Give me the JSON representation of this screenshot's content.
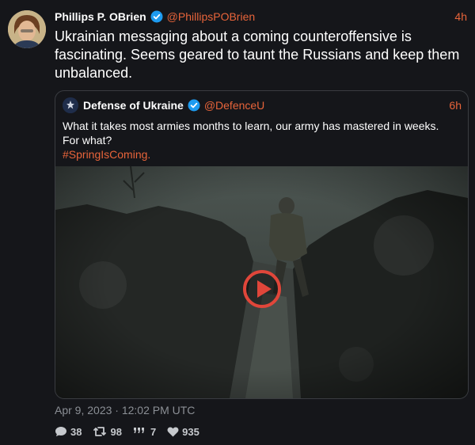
{
  "tweet": {
    "author_name": "Phillips P. OBrien",
    "handle": "@PhillipsPOBrien",
    "time": "4h",
    "text": "Ukrainian messaging about a coming counteroffensive is fascinating. Seems geared to taunt the Russians and keep them unbalanced.",
    "timestamp": "Apr 9, 2023 · 12:02 PM UTC",
    "stats": {
      "replies": "38",
      "retweets": "98",
      "quotes": "7",
      "likes": "935"
    }
  },
  "quoted": {
    "author_name": "Defense of Ukraine",
    "handle": "@DefenceU",
    "time": "6h",
    "text_line1": "What it takes most armies months to learn, our army has mastered in weeks.",
    "text_line2": "For what?",
    "hashtag": "#SpringIsComing",
    "hashtag_suffix": "."
  },
  "colors": {
    "background": "#15161a",
    "accent": "#e8643a",
    "verified": "#1d9bf0",
    "play_button": "#e0463a"
  },
  "icons": {
    "verified": "verified-badge-icon",
    "play": "play-icon",
    "reply": "reply-icon",
    "retweet": "retweet-icon",
    "quote": "quote-icon",
    "like": "heart-icon"
  }
}
